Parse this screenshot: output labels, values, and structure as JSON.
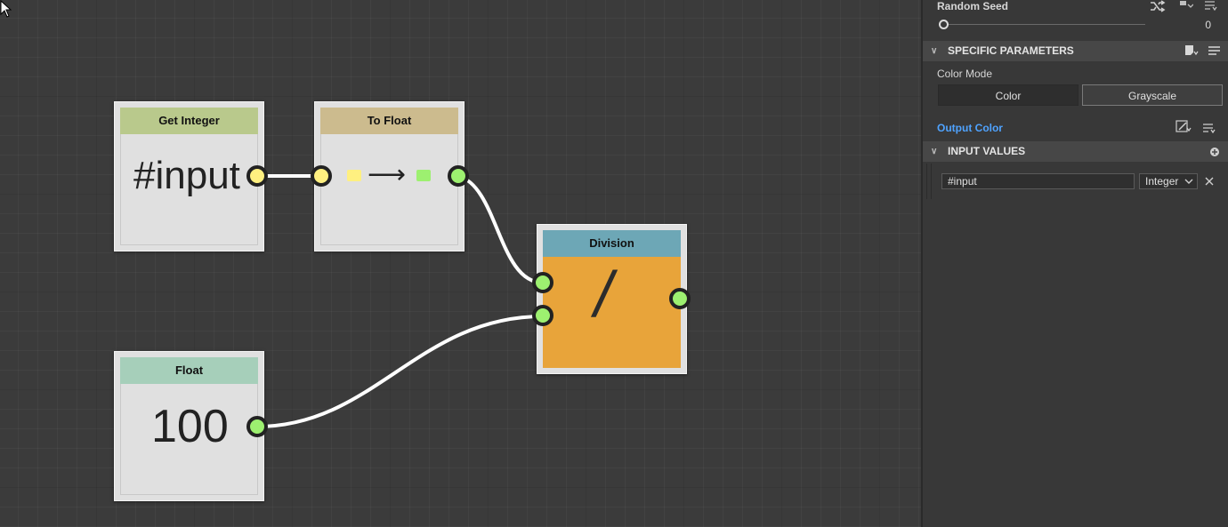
{
  "nodes": {
    "get_integer": {
      "title": "Get Integer",
      "value": "#input",
      "header_color": "#b9c98c"
    },
    "to_float": {
      "title": "To Float",
      "arrow": "⟶",
      "header_color": "#ccbb8e"
    },
    "float_node": {
      "title": "Float",
      "value": "100",
      "header_color": "#a6cfba"
    },
    "division": {
      "title": "Division",
      "symbol": "/",
      "header_color": "#6da7b6",
      "body_color": "#e8a43a"
    }
  },
  "panel": {
    "random_seed": {
      "label": "Random Seed",
      "value": "0"
    },
    "specific_parameters": {
      "title": "SPECIFIC PARAMETERS"
    },
    "color_mode": {
      "label": "Color Mode",
      "options": [
        "Color",
        "Grayscale"
      ],
      "selected": "Grayscale"
    },
    "output_color": {
      "label": "Output Color",
      "color": "#4fa3ff"
    },
    "input_values": {
      "title": "INPUT VALUES",
      "row": {
        "name": "#input",
        "type": "Integer"
      }
    }
  },
  "colors": {
    "port_yellow": "#fff080",
    "port_green": "#9df070",
    "accent_blue": "#4fa3ff"
  },
  "icons": [
    "shuffle-icon",
    "pin-icon",
    "menu-icon",
    "bookmark-icon",
    "edit-icon",
    "add-icon",
    "close-icon",
    "chevron-down-icon",
    "cursor-icon"
  ]
}
